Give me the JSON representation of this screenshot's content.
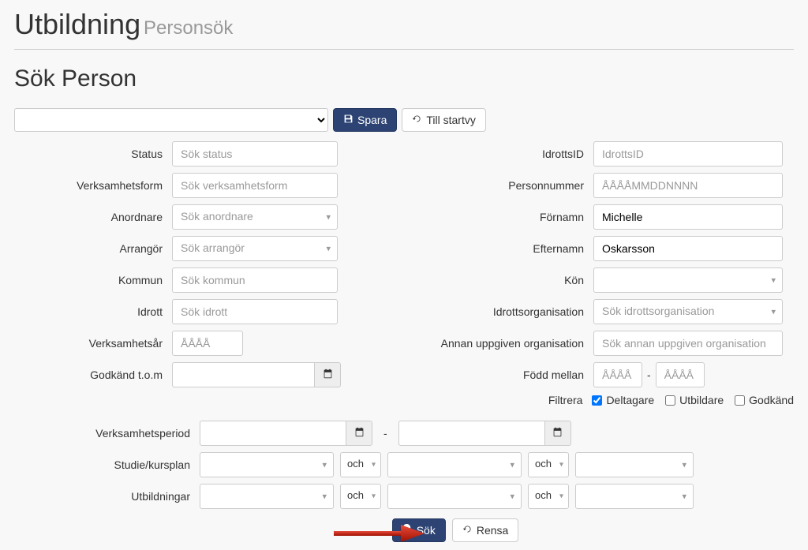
{
  "header": {
    "title": "Utbildning",
    "subtitle": "Personsök"
  },
  "section_title": "Sök Person",
  "toolbar": {
    "save_label": "Spara",
    "home_label": "Till startvy"
  },
  "left": {
    "status": {
      "label": "Status",
      "placeholder": "Sök status"
    },
    "verksamhetsform": {
      "label": "Verksamhetsform",
      "placeholder": "Sök verksamhetsform"
    },
    "anordnare": {
      "label": "Anordnare",
      "placeholder": "Sök anordnare"
    },
    "arrangor": {
      "label": "Arrangör",
      "placeholder": "Sök arrangör"
    },
    "kommun": {
      "label": "Kommun",
      "placeholder": "Sök kommun"
    },
    "idrott": {
      "label": "Idrott",
      "placeholder": "Sök idrott"
    },
    "verksamhetsar": {
      "label": "Verksamhetsår",
      "placeholder": "ÅÅÅÅ"
    },
    "godkand_tom": {
      "label": "Godkänd t.o.m"
    }
  },
  "right": {
    "idrottsid": {
      "label": "IdrottsID",
      "placeholder": "IdrottsID"
    },
    "personnummer": {
      "label": "Personnummer",
      "placeholder": "ÅÅÅÅMMDDNNNN"
    },
    "fornamn": {
      "label": "Förnamn",
      "value": "Michelle"
    },
    "efternamn": {
      "label": "Efternamn",
      "value": "Oskarsson"
    },
    "kon": {
      "label": "Kön"
    },
    "idrottsorg": {
      "label": "Idrottsorganisation",
      "placeholder": "Sök idrottsorganisation"
    },
    "annan_org": {
      "label": "Annan uppgiven organisation",
      "placeholder": "Sök annan uppgiven organisation"
    },
    "fodd_mellan": {
      "label": "Född mellan",
      "from_placeholder": "ÅÅÅÅ",
      "to_placeholder": "ÅÅÅÅ",
      "dash": "-"
    },
    "filtrera": {
      "label": "Filtrera",
      "deltagare": "Deltagare",
      "utbildare": "Utbildare",
      "godkand": "Godkänd",
      "deltagare_checked": true,
      "utbildare_checked": false,
      "godkand_checked": false
    }
  },
  "bottom": {
    "verksamhetsperiod": {
      "label": "Verksamhetsperiod",
      "dash": "-"
    },
    "studieplan": {
      "label": "Studie/kursplan",
      "connector": "och"
    },
    "utbildningar": {
      "label": "Utbildningar",
      "connector": "och"
    }
  },
  "actions": {
    "search": "Sök",
    "clear": "Rensa"
  }
}
